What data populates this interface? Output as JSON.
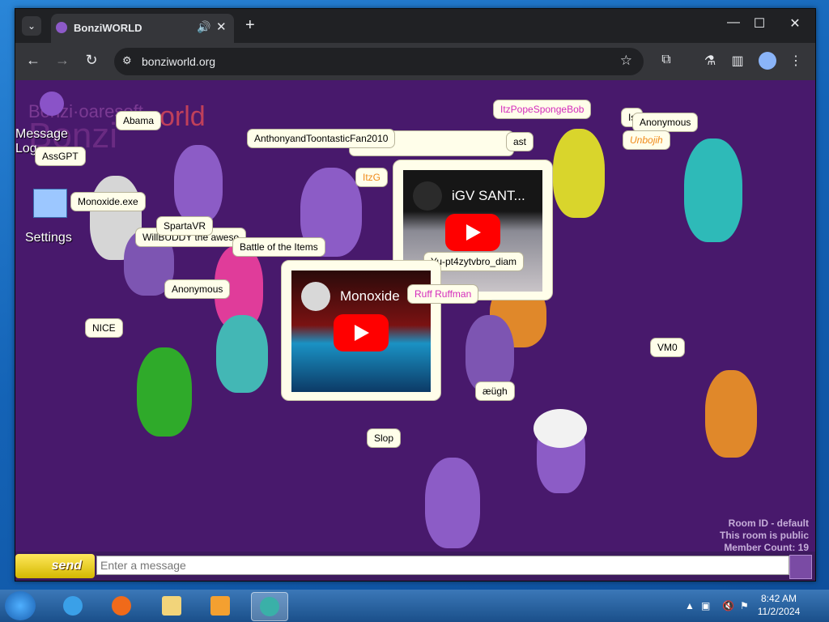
{
  "browser": {
    "tab_title": "BonziWORLD",
    "url": "bonziworld.org",
    "new_tab": "+",
    "audio_icon": "speaker-icon"
  },
  "sidebar": {
    "logo_small": "Bonzi·oaresoft",
    "logo_big": "Bonzi",
    "logo_world": "orld",
    "message_log_line1": "Message",
    "message_log_line2": "Log",
    "settings": "Settings"
  },
  "bubbles": {
    "abama": "Abama",
    "assgpt": "AssGPT",
    "monoxide": "Monoxide.exe",
    "spartavr": "SpartaVR",
    "willbuddy": "WillBUDDY the aweso",
    "battle": "Battle of the Items",
    "anonymous_left": "Anonymous",
    "nice": "NICE",
    "anthony": "AnthonyandToontasticFan2010",
    "itzg": "ItzG",
    "pope": "ItzPopeSpongeBob",
    "anonymous_right": "Anonymous",
    "is": "Is",
    "unbojih": "Unbojih",
    "yu": "Yu-pt4zytvbro_diam",
    "ruff": "Ruff Ruffman",
    "vm0": "VM0",
    "augh": "æügh",
    "slop": "Slop",
    "cut_text": "ast"
  },
  "videos": {
    "video1_title": "iGV SANT...",
    "video2_title": "Monoxide"
  },
  "room": {
    "room_id": "Room ID - default",
    "visibility": "This room is public",
    "members": "Member Count: 19"
  },
  "chat": {
    "send_label": "send",
    "placeholder": "Enter a message"
  },
  "taskbar": {
    "time": "8:42 AM",
    "date": "11/2/2024"
  },
  "colors": {
    "room_bg": "#48196c",
    "bubble_bg": "#fffeea",
    "pink_name": "#d42bbc",
    "send_yellow": "#ffe85c"
  }
}
